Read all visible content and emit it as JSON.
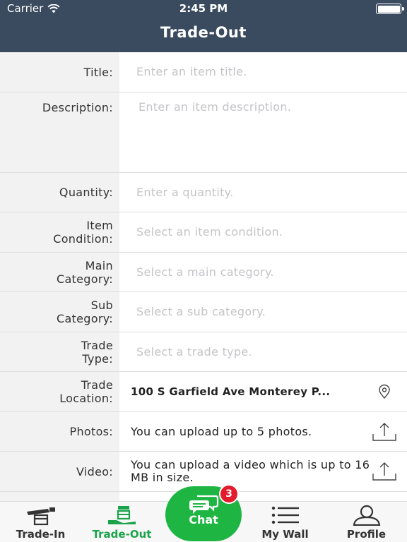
{
  "status_bar": {
    "carrier": "Carrier",
    "time": "2:45 PM"
  },
  "nav": {
    "title": "Trade-Out"
  },
  "form": {
    "title": {
      "label": "Title:",
      "placeholder": "Enter an item title."
    },
    "description": {
      "label": "Description:",
      "placeholder": "Enter an item description."
    },
    "quantity": {
      "label": "Quantity:",
      "placeholder": "Enter a quantity."
    },
    "item_condition": {
      "label_line1": "Item",
      "label_line2": "Condition:",
      "placeholder": "Select an item condition."
    },
    "main_category": {
      "label_line1": "Main",
      "label_line2": "Category:",
      "placeholder": "Select a main category."
    },
    "sub_category": {
      "label_line1": "Sub",
      "label_line2": "Category:",
      "placeholder": "Select a sub category."
    },
    "trade_type": {
      "label_line1": "Trade",
      "label_line2": "Type:",
      "placeholder": "Select a trade type."
    },
    "trade_location": {
      "label_line1": "Trade",
      "label_line2": "Location:",
      "value": "100 S Garfield Ave Monterey P..."
    },
    "photos": {
      "label": "Photos:",
      "value": "You can upload up to 5 photos."
    },
    "video": {
      "label": "Video:",
      "value": "You can upload a video which is up to 16 MB in size."
    }
  },
  "tabbar": {
    "trade_in": "Trade-In",
    "trade_out": "Trade-Out",
    "chat": "Chat",
    "chat_badge": "3",
    "my_wall": "My Wall",
    "profile": "Profile"
  },
  "colors": {
    "nav_bg": "#3a4a5f",
    "accent_green": "#1eb543",
    "active_tab": "#1aa34a",
    "badge_red": "#e21b2d"
  }
}
